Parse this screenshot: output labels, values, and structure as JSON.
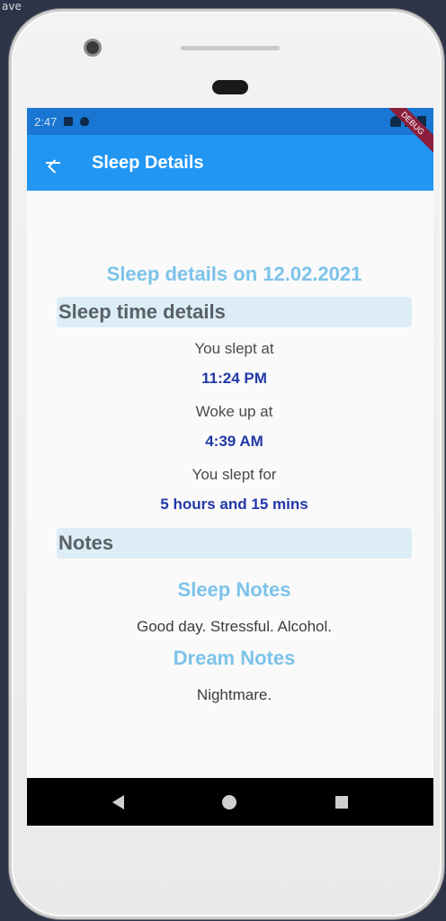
{
  "background_text": "ave",
  "status_bar": {
    "time": "2:47",
    "debug_label": "DEBUG"
  },
  "app_bar": {
    "title": "Sleep Details"
  },
  "details": {
    "heading": "Sleep details on 12.02.2021",
    "sleep_section_title": "Sleep time details",
    "slept_at_label": "You slept at",
    "slept_at_value": "11:24 PM",
    "woke_up_label": "Woke up at",
    "woke_up_value": "4:39 AM",
    "slept_for_label": "You slept for",
    "slept_for_value": "5 hours and 15 mins",
    "notes_section_title": "Notes",
    "sleep_notes_title": "Sleep Notes",
    "sleep_notes_text": "Good day. Stressful. Alcohol.",
    "dream_notes_title": "Dream Notes",
    "dream_notes_text": "Nightmare."
  },
  "colors": {
    "status_bar": "#1976d2",
    "app_bar": "#2196f3",
    "accent_heading": "#7cc3ea",
    "value_text": "#2238a8",
    "section_bg": "#dcedf7"
  }
}
